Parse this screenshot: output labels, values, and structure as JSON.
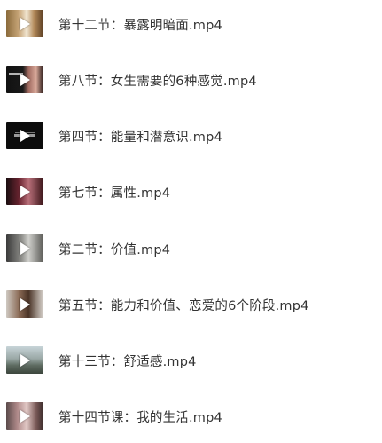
{
  "items": [
    {
      "title": "第十二节：暴露明暗面.mp4",
      "thumbnail": "video-thumbnail",
      "icon": "play-icon"
    },
    {
      "title": "第八节：女生需要的6种感觉.mp4",
      "thumbnail": "video-thumbnail",
      "icon": "play-icon"
    },
    {
      "title": "第四节：能量和潜意识.mp4",
      "thumbnail": "video-thumbnail",
      "icon": "play-icon"
    },
    {
      "title": "第七节：属性.mp4",
      "thumbnail": "video-thumbnail",
      "icon": "play-icon"
    },
    {
      "title": "第二节：价值.mp4",
      "thumbnail": "video-thumbnail",
      "icon": "play-icon"
    },
    {
      "title": "第五节：能力和价值、恋爱的6个阶段.mp4",
      "thumbnail": "video-thumbnail",
      "icon": "play-icon"
    },
    {
      "title": "第十三节：舒适感.mp4",
      "thumbnail": "video-thumbnail",
      "icon": "play-icon"
    },
    {
      "title": "第十四节课：我的生活.mp4",
      "thumbnail": "video-thumbnail",
      "icon": "play-icon"
    }
  ]
}
